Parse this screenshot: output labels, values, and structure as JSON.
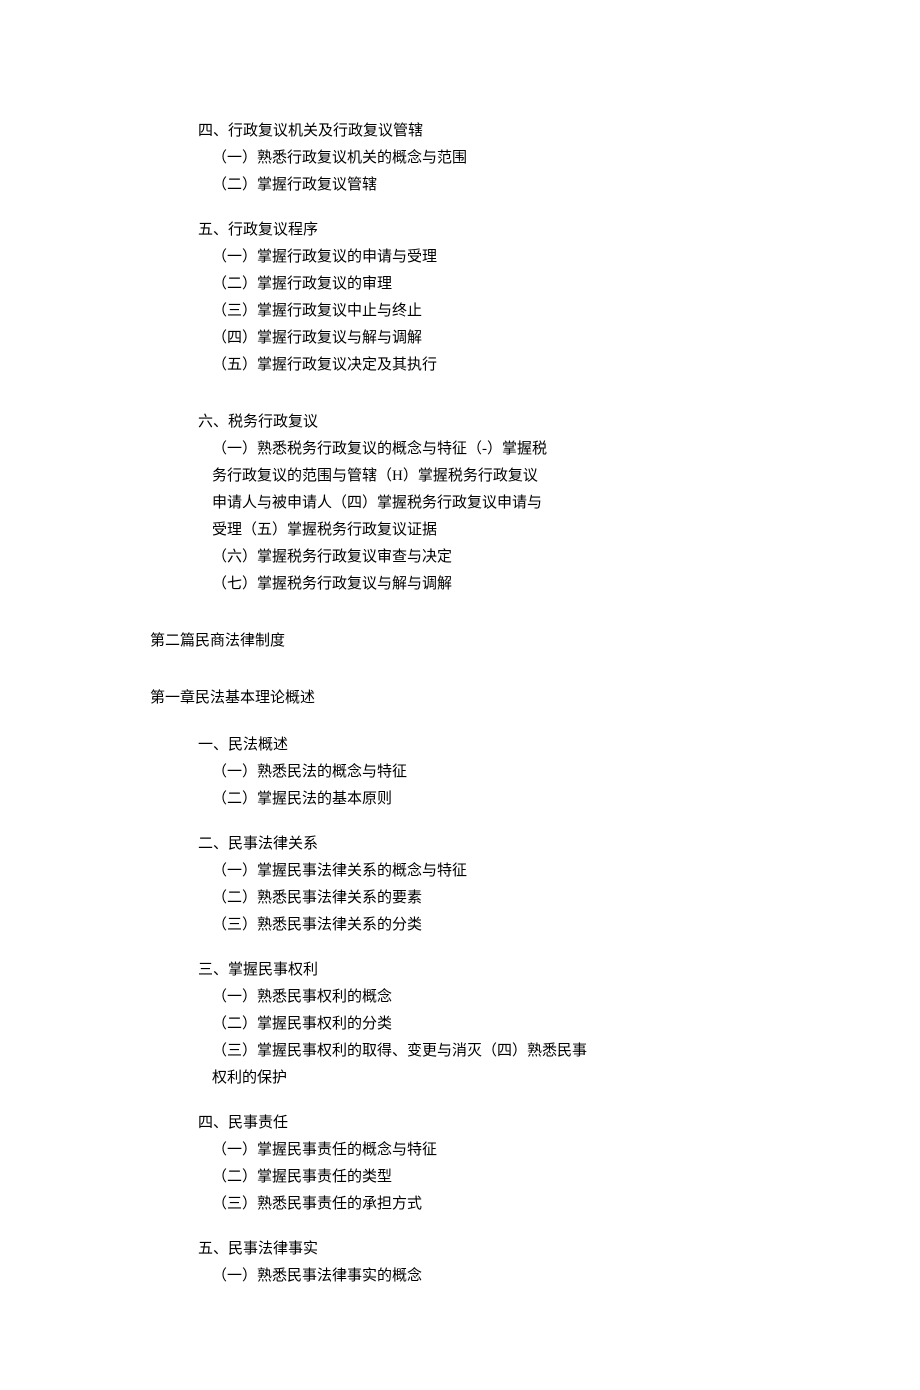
{
  "s4": {
    "title": "四、行政复议机关及行政复议管辖",
    "items": [
      "（一）熟悉行政复议机关的概念与范围",
      "（二）掌握行政复议管辖"
    ]
  },
  "s5": {
    "title": "五、行政复议程序",
    "items": [
      "（一）掌握行政复议的申请与受理",
      "（二）掌握行政复议的审理",
      "（三）掌握行政复议中止与终止",
      "（四）掌握行政复议与解与调解",
      "（五）掌握行政复议决定及其执行"
    ]
  },
  "s6": {
    "title": "六、税务行政复议",
    "wrap": "（一）熟悉税务行政复议的概念与特征（-）掌握税务行政复议的范围与管辖（H）掌握税务行政复议申请人与被申请人（四）掌握税务行政复议申请与受理（五）掌握税务行政复议证据",
    "items": [
      "（六）掌握税务行政复议审查与决定",
      "（七）掌握税务行政复议与解与调解"
    ]
  },
  "part2": {
    "title": "第二篇民商法律制度"
  },
  "chapter1": {
    "title": "第一章民法基本理论概述",
    "s1": {
      "title": "一、民法概述",
      "items": [
        "（一）熟悉民法的概念与特征",
        "（二）掌握民法的基本原则"
      ]
    },
    "s2": {
      "title": "二、民事法律关系",
      "items": [
        "（一）掌握民事法律关系的概念与特征",
        "（二）熟悉民事法律关系的要素",
        "（三）熟悉民事法律关系的分类"
      ]
    },
    "s3": {
      "title": "三、掌握民事权利",
      "items": [
        "（一）熟悉民事权利的概念",
        "（二）掌握民事权利的分类"
      ],
      "wrap": "（三）掌握民事权利的取得、变更与消灭（四）熟悉民事权利的保护"
    },
    "s4": {
      "title": "四、民事责任",
      "items": [
        "（一）掌握民事责任的概念与特征",
        "（二）掌握民事责任的类型",
        "（三）熟悉民事责任的承担方式"
      ]
    },
    "s5": {
      "title": "五、民事法律事实",
      "items": [
        "（一）熟悉民事法律事实的概念"
      ]
    }
  }
}
